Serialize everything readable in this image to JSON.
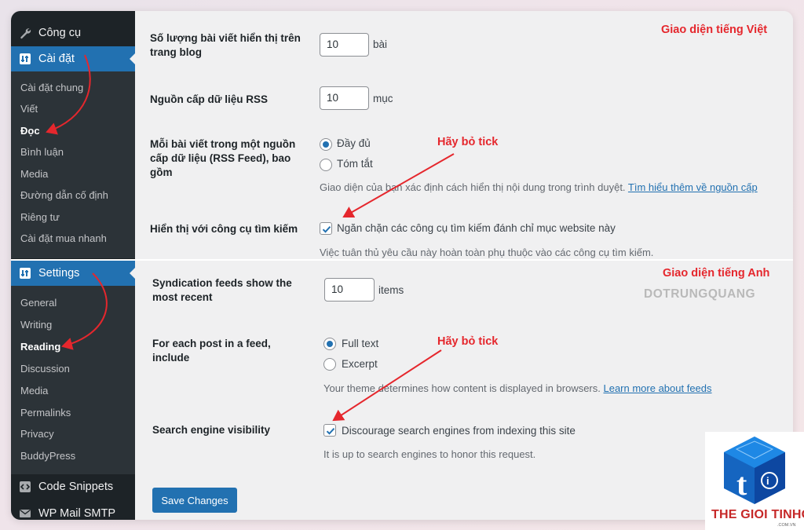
{
  "sidebar_top": {
    "tools_label": "Công cụ",
    "settings_vi_label": "Cài đặt",
    "vi_items": [
      "Cài đặt chung",
      "Viết",
      "Đọc",
      "Bình luận",
      "Media",
      "Đường dẫn cố định",
      "Riêng tư",
      "Cài đặt mua nhanh"
    ],
    "settings_en_label": "Settings",
    "en_items": [
      "General",
      "Writing",
      "Reading",
      "Discussion",
      "Media",
      "Permalinks",
      "Privacy",
      "BuddyPress"
    ],
    "code_snippets_label": "Code Snippets",
    "wp_mail_label": "WP Mail SMTP"
  },
  "vi": {
    "panel_note": "Giao diện tiếng Việt",
    "posts_label": "Số lượng bài viết hiển thị trên trang blog",
    "posts_value": "10",
    "posts_unit": "bài",
    "rss_label": "Nguồn cấp dữ liệu RSS",
    "rss_value": "10",
    "rss_unit": "mục",
    "feed_label": "Mỗi bài viết trong một nguồn cấp dữ liệu (RSS Feed), bao gồm",
    "full_text": "Đầy đủ",
    "excerpt": "Tóm tắt",
    "feed_desc": "Giao diện của bạn xác định cách hiển thị nội dung trong trình duyệt. ",
    "feed_desc_link": "Tìm hiểu thêm về nguồn cấp",
    "search_label": "Hiển thị với công cụ tìm kiếm",
    "search_checkbox": "Ngăn chặn các công cụ tìm kiếm đánh chỉ mục website này",
    "search_desc": "Việc tuân thủ yêu cầu này hoàn toàn phụ thuộc vào các công cụ tìm kiếm.",
    "annotation": "Hãy bỏ tick"
  },
  "en": {
    "panel_note": "Giao diện tiếng Anh",
    "posts_label": "Syndication feeds show the most recent",
    "posts_value": "10",
    "posts_unit": "items",
    "feed_label": "For each post in a feed, include",
    "full_text": "Full text",
    "excerpt": "Excerpt",
    "feed_desc": "Your theme determines how content is displayed in browsers. ",
    "feed_desc_link": "Learn more about feeds",
    "search_label": "Search engine visibility",
    "search_checkbox": "Discourage search engines from indexing this site",
    "search_desc": "It is up to search engines to honor this request.",
    "annotation": "Hãy bỏ tick",
    "save_button": "Save Changes"
  },
  "branding": {
    "watermark": "DOTRUNGQUANG",
    "logo_text": "THE GIOI TINHOC",
    "logo_sub": ".COM.VN"
  },
  "colors": {
    "sidebar_bg": "#1d2327",
    "submenu_bg": "#2c3338",
    "accent": "#2271b1",
    "annotation": "#e5272d"
  },
  "state": {
    "vi_full_text_selected": true,
    "vi_discourage_checked": true,
    "en_full_text_selected": true,
    "en_discourage_checked": true
  }
}
